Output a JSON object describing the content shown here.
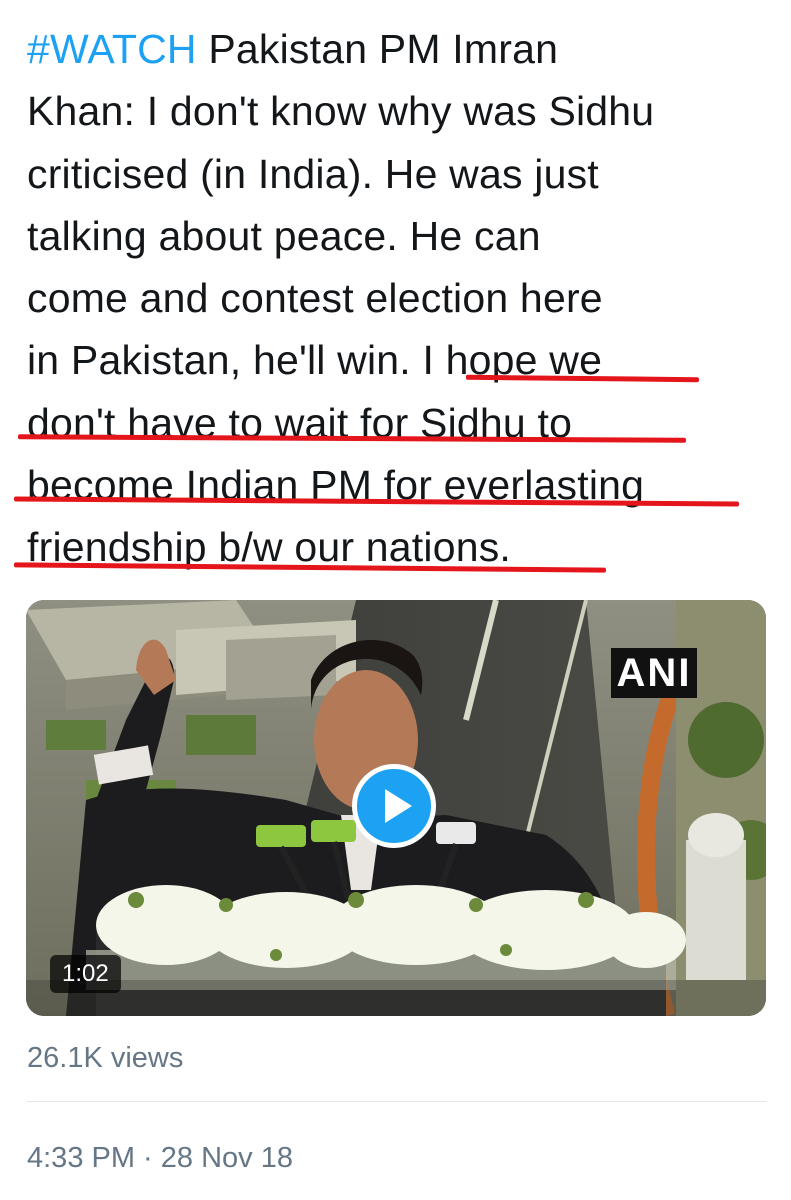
{
  "tweet": {
    "hashtag": "#WATCH",
    "lines": [
      " Pakistan PM Imran",
      "Khan: I don't know why was Sidhu",
      "criticised (in India). He was just",
      "talking about peace. He can",
      "come and contest election here",
      "in Pakistan, he'll win. I hope we",
      "don't have to wait for Sidhu to",
      "become Indian PM for everlasting",
      "friendship b/w our nations."
    ]
  },
  "video": {
    "watermark": "ANI",
    "duration": "1:02",
    "play_icon": "play-icon"
  },
  "stats": {
    "views": "26.1K views"
  },
  "meta": {
    "timestamp": "4:33 PM · 28 Nov 18"
  },
  "colors": {
    "hashtag": "#1da1f2",
    "underline": "#e4151b",
    "text": "#14171a",
    "secondary": "#657786",
    "play_button": "#1da1f2"
  }
}
